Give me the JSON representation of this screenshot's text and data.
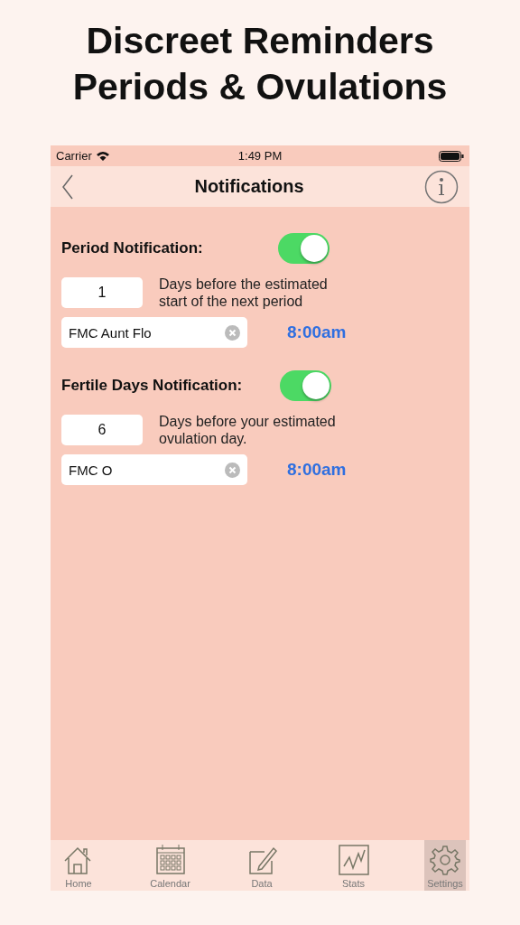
{
  "headline": [
    "Discreet Reminders",
    "Periods & Ovulations"
  ],
  "status_bar": {
    "carrier": "Carrier",
    "time": "1:49 PM"
  },
  "nav": {
    "title": "Notifications"
  },
  "sections": [
    {
      "label": "Period Notification:",
      "on": true,
      "days": "1",
      "description": "Days before the estimated start of the next period",
      "name": "FMC Aunt Flo",
      "time": "8:00am"
    },
    {
      "label": "Fertile Days Notification:",
      "on": true,
      "days": "6",
      "description": "Days before your estimated ovulation day.",
      "name": "FMC O",
      "time": "8:00am"
    }
  ],
  "tabs": [
    {
      "kind": "home",
      "label": "Home",
      "selected": false
    },
    {
      "kind": "calendar",
      "label": "Calendar",
      "selected": false
    },
    {
      "kind": "data",
      "label": "Data",
      "selected": false
    },
    {
      "kind": "stats",
      "label": "Stats",
      "selected": false
    },
    {
      "kind": "settings",
      "label": "Settings",
      "selected": true
    }
  ]
}
